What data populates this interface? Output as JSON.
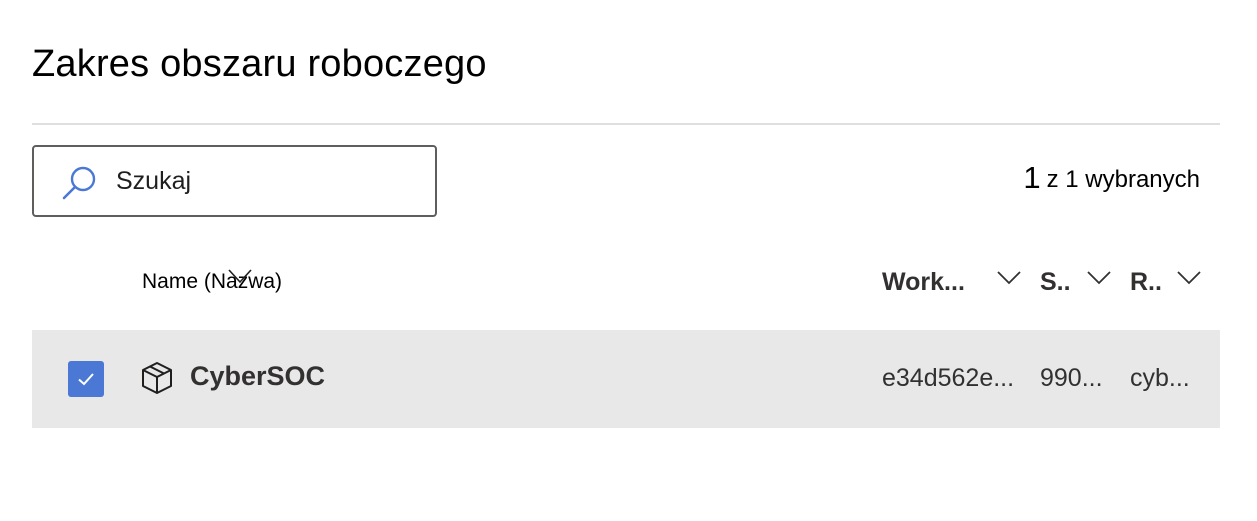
{
  "page": {
    "title": "Zakres obszaru roboczego"
  },
  "search": {
    "placeholder": "Szukaj",
    "icon": "search-icon"
  },
  "selection": {
    "count": "1",
    "label": "z 1 wybranych"
  },
  "columns": {
    "name": "Name (Nazwa)",
    "workspace": "Work...",
    "subscription": "S..",
    "resource_group": "R.."
  },
  "rows": [
    {
      "checked": true,
      "icon": "cube-icon",
      "name": "CyberSOC",
      "workspace_id": "e34d562e...",
      "subscription": "990...",
      "resource_group": "cyb..."
    }
  ],
  "colors": {
    "accent": "#4a78d4",
    "row_selected_bg": "#e8e8e8",
    "divider": "#e1dfdd"
  }
}
